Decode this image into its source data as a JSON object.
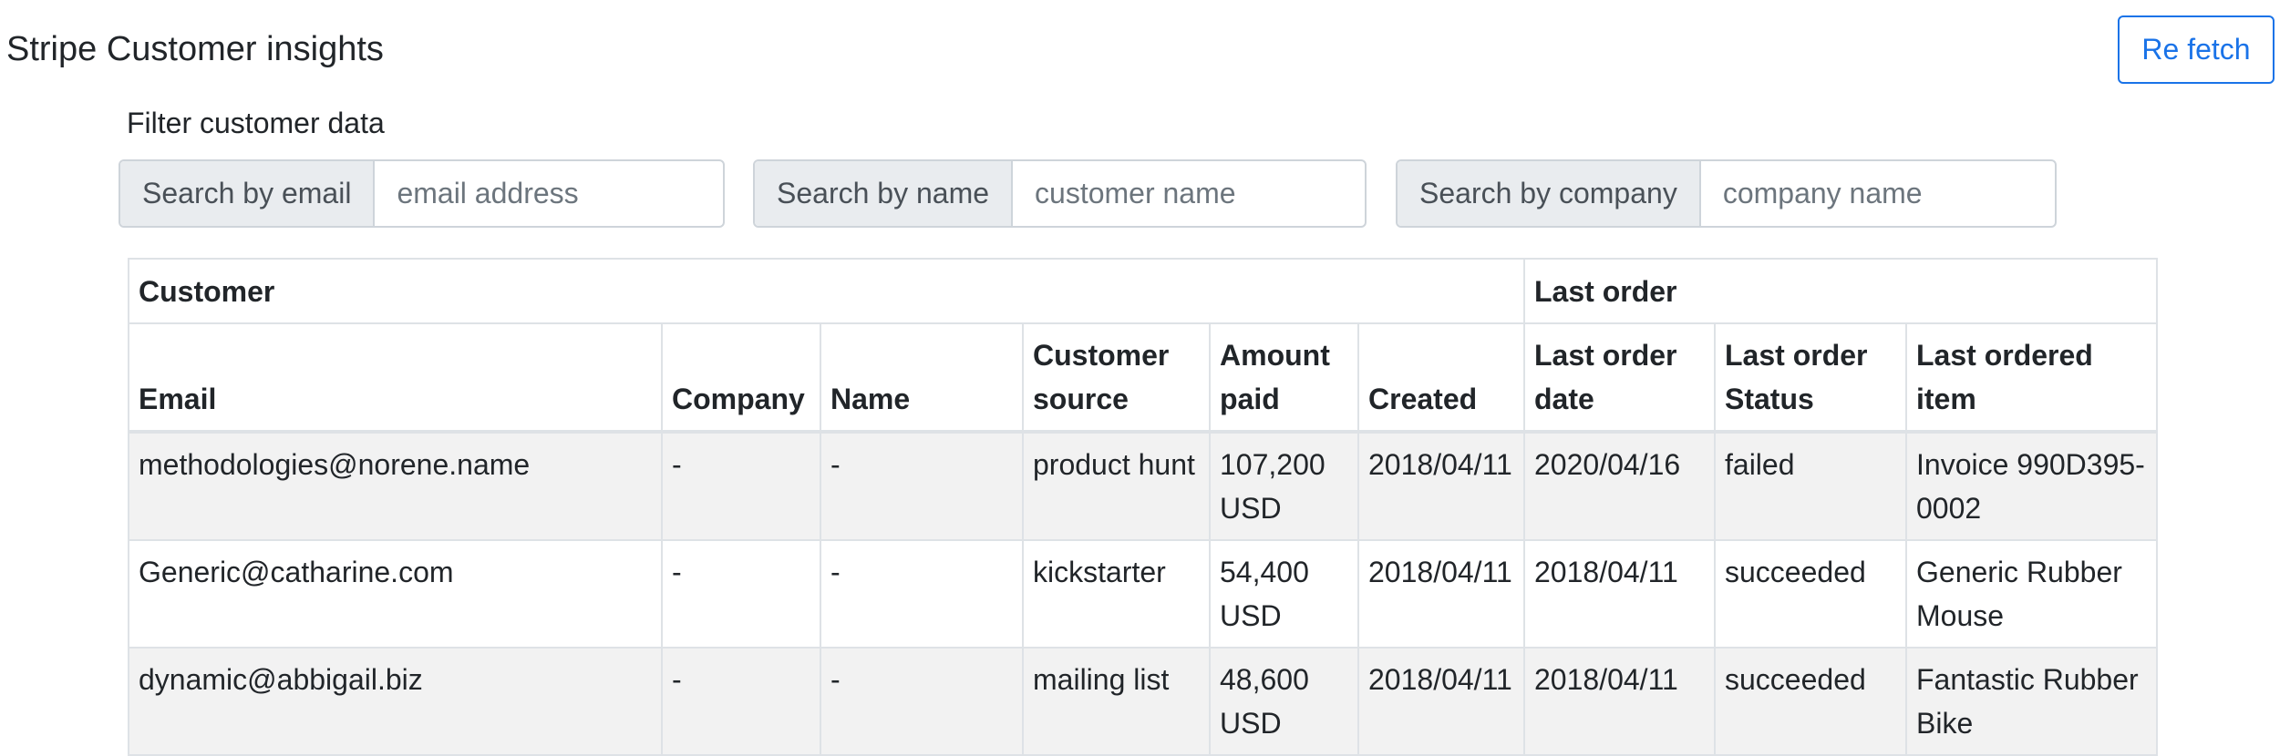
{
  "header": {
    "title": "Stripe Customer insights",
    "refetch_label": "Re fetch",
    "accent_color": "#1a73e8"
  },
  "filters": {
    "label": "Filter customer data",
    "email": {
      "addon": "Search by email",
      "placeholder": "email address",
      "icon": "contact-card-icon"
    },
    "name": {
      "addon": "Search by name",
      "placeholder": "customer name"
    },
    "company": {
      "addon": "Search by company",
      "placeholder": "company name"
    }
  },
  "table": {
    "groups": {
      "customer": "Customer",
      "last_order": "Last order"
    },
    "columns": {
      "email": "Email",
      "company": "Company",
      "name": "Name",
      "source": "Customer source",
      "amount": "Amount paid",
      "created": "Created",
      "last_date": "Last order date",
      "last_status": "Last order Status",
      "last_item": "Last ordered item"
    },
    "rows": [
      {
        "email": "methodologies@norene.name",
        "company": "-",
        "name": "-",
        "source": "product hunt",
        "amount": "107,200 USD",
        "created": "2018/04/11",
        "last_date": "2020/04/16",
        "last_status": "failed",
        "last_item": "Invoice 990D395-0002"
      },
      {
        "email": "Generic@catharine.com",
        "company": "-",
        "name": "-",
        "source": "kickstarter",
        "amount": "54,400 USD",
        "created": "2018/04/11",
        "last_date": "2018/04/11",
        "last_status": "succeeded",
        "last_item": "Generic Rubber Mouse"
      },
      {
        "email": "dynamic@abbigail.biz",
        "company": "-",
        "name": "-",
        "source": "mailing list",
        "amount": "48,600 USD",
        "created": "2018/04/11",
        "last_date": "2018/04/11",
        "last_status": "succeeded",
        "last_item": "Fantastic Rubber Bike"
      }
    ]
  }
}
